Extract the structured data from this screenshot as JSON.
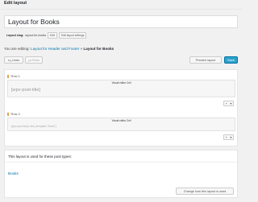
{
  "header": {
    "title": "Edit layout"
  },
  "layout": {
    "name": "Layout for Books",
    "slug_label": "Layout slug:",
    "slug_value": "layout-for-books",
    "edit_label": "Edit",
    "settings_label": "Edit layout settings"
  },
  "editing": {
    "prefix": "You are editing:",
    "parent_link": "Layout for Header and Footer",
    "separator": "»",
    "current": "Layout for Books"
  },
  "toolbar": {
    "undo_label": "Undo",
    "redo_label": "Redo",
    "preview_label": "Preview layout",
    "save_label": "Save"
  },
  "rows": [
    {
      "label": "Row 1",
      "cell_label": "Visual editor Cell",
      "content": "[wpv-post-title]"
    },
    {
      "label": "Row 2",
      "cell_label": "Visual editor Cell",
      "content": "[wpv-post-body view_template=\"None\"]"
    }
  ],
  "row_controls": {
    "add": "+",
    "menu": "▾"
  },
  "usage": {
    "title": "This layout is used for these post types:",
    "post_type": "Books",
    "change_button": "Change how this layout is used"
  },
  "colors": {
    "accent": "#0073aa",
    "primary_button": "#2ea2cc",
    "row_handle": "#e0a34e"
  }
}
